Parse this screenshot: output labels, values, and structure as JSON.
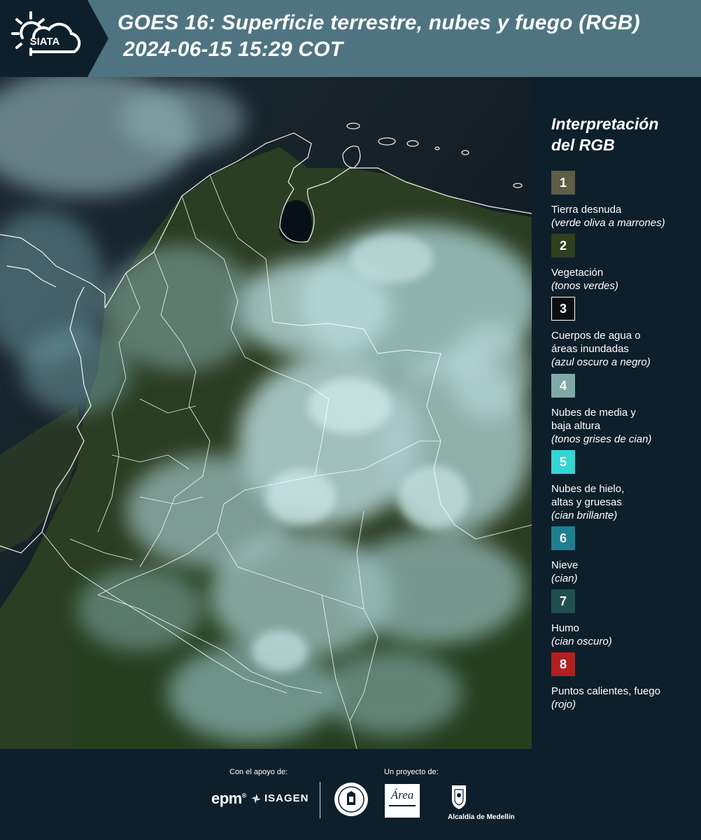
{
  "header": {
    "logo_text": "SIATA",
    "title_line1": "GOES 16: Superficie terrestre, nubes y fuego (RGB)",
    "title_line2": "2024-06-15 15:29 COT"
  },
  "legend": {
    "title_line1": "Interpretación",
    "title_line2": "del RGB",
    "items": [
      {
        "number": "1",
        "color": "#5e5d45",
        "label": "Tierra desnuda",
        "note": "(verde oliva a marrones)"
      },
      {
        "number": "2",
        "color": "#2f3f1f",
        "label": "Vegetación",
        "note": "(tonos verdes)"
      },
      {
        "number": "3",
        "color": "#0b0f12",
        "label": "Cuerpos de agua o áreas inundadas",
        "note": "(azul oscuro a negro)"
      },
      {
        "number": "4",
        "color": "#7fa9a6",
        "label": "Nubes de media y baja altura",
        "note": "(tonos grises de cian)"
      },
      {
        "number": "5",
        "color": "#35d5d5",
        "label": "Nubes de hielo, altas y gruesas",
        "note": "(cian brillante)"
      },
      {
        "number": "6",
        "color": "#1e7f92",
        "label": "Nieve",
        "note": "(cian)"
      },
      {
        "number": "7",
        "color": "#1f4f4f",
        "label": "Humo",
        "note": "(cian oscuro)"
      },
      {
        "number": "8",
        "color": "#b21f1f",
        "label": "Puntos calientes, fuego",
        "note": "(rojo)"
      }
    ]
  },
  "footer": {
    "support_label": "Con el apoyo de:",
    "project_label": "Un proyecto de:",
    "epm": "epm",
    "isagen": "ISAGEN",
    "amva": "Área",
    "medellin": "Alcaldía de Medellín"
  },
  "colors": {
    "header_bg": "#4f7481",
    "panel_bg": "#0c1f2b"
  }
}
